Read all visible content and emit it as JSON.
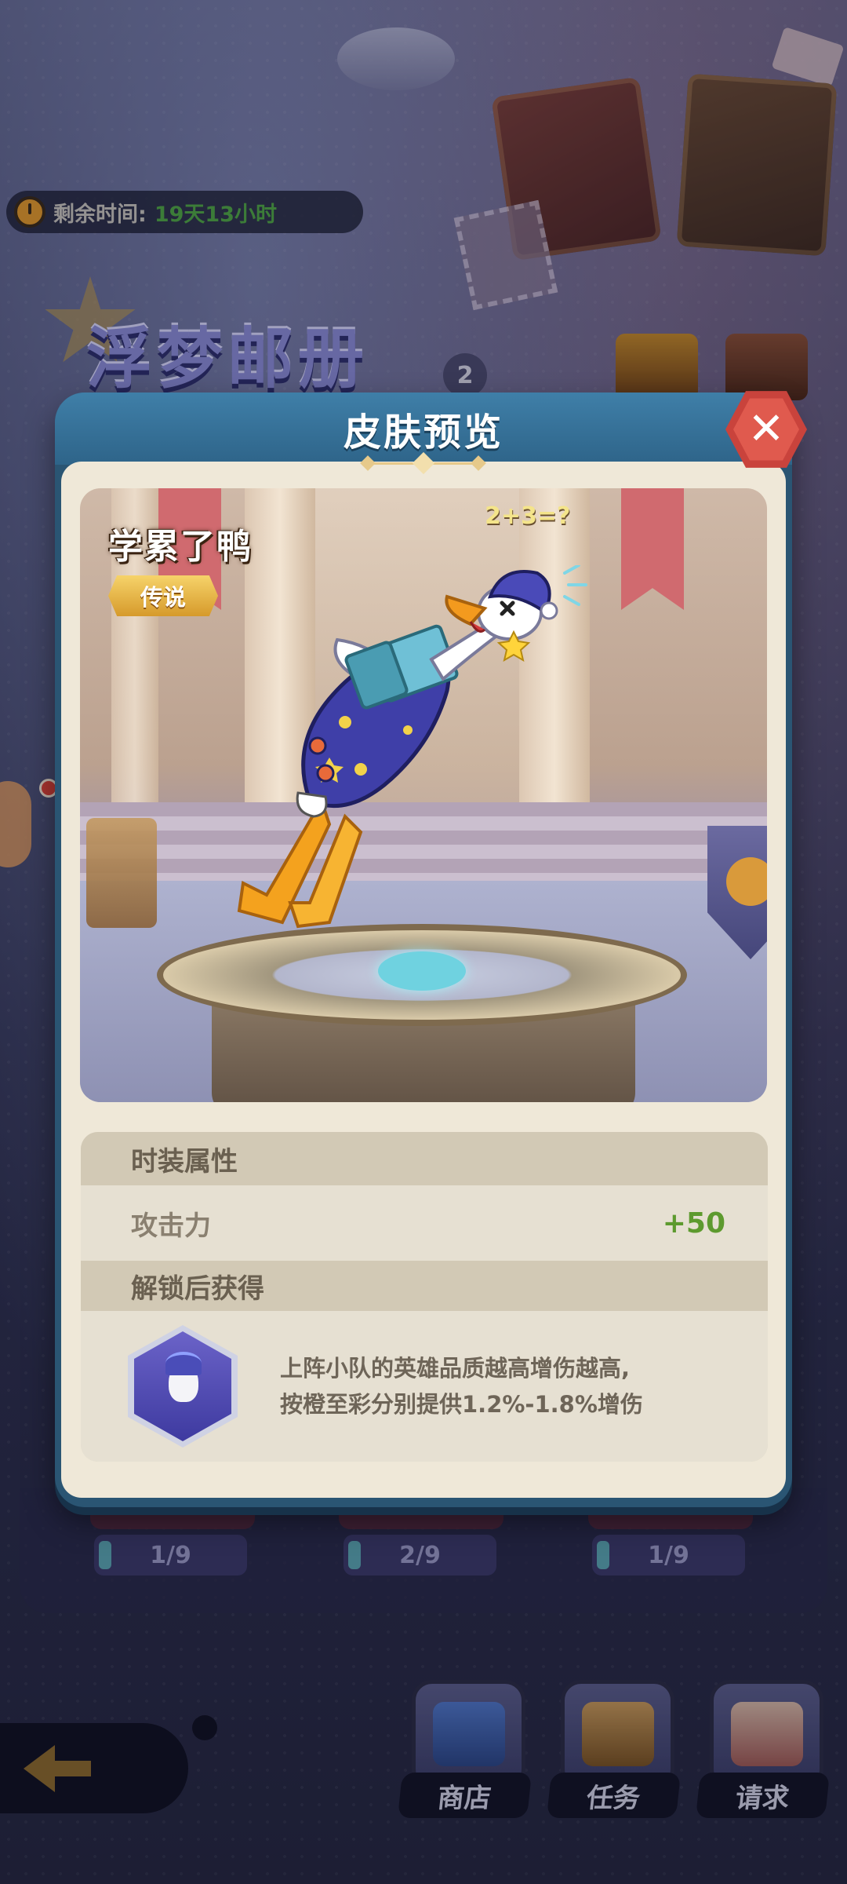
{
  "timer": {
    "label": "剩余时间:",
    "value": "19天13小时"
  },
  "event": {
    "title": "浮梦邮册",
    "help_badge": "2"
  },
  "dialog": {
    "title": "皮肤预览",
    "close_icon": "close-icon"
  },
  "skin": {
    "name": "学累了鸭",
    "rarity": "传说",
    "scene_note": "2+3=?"
  },
  "stats": {
    "section_title": "时装属性",
    "attack_label": "攻击力",
    "attack_value": "+50",
    "unlock_title": "解锁后获得",
    "bonus_line1": "上阵小队的英雄品质越高增伤越高,",
    "bonus_line2": "按橙至彩分别提供1.2%-1.8%增伤",
    "bonus_icon": "sleepy-goose-buff-icon"
  },
  "progress": [
    "1/9",
    "2/9",
    "1/9"
  ],
  "nav": {
    "shop": "商店",
    "task": "任务",
    "request": "请求",
    "back_icon": "back-arrow-icon"
  },
  "colors": {
    "dialog_frame": "#2a5573",
    "dialog_body": "#efe8d8",
    "close_button": "#e05a4e",
    "stat_positive": "#5d9a2e",
    "rarity_gold": "#f6d36a",
    "timer_value": "#4fa845"
  }
}
